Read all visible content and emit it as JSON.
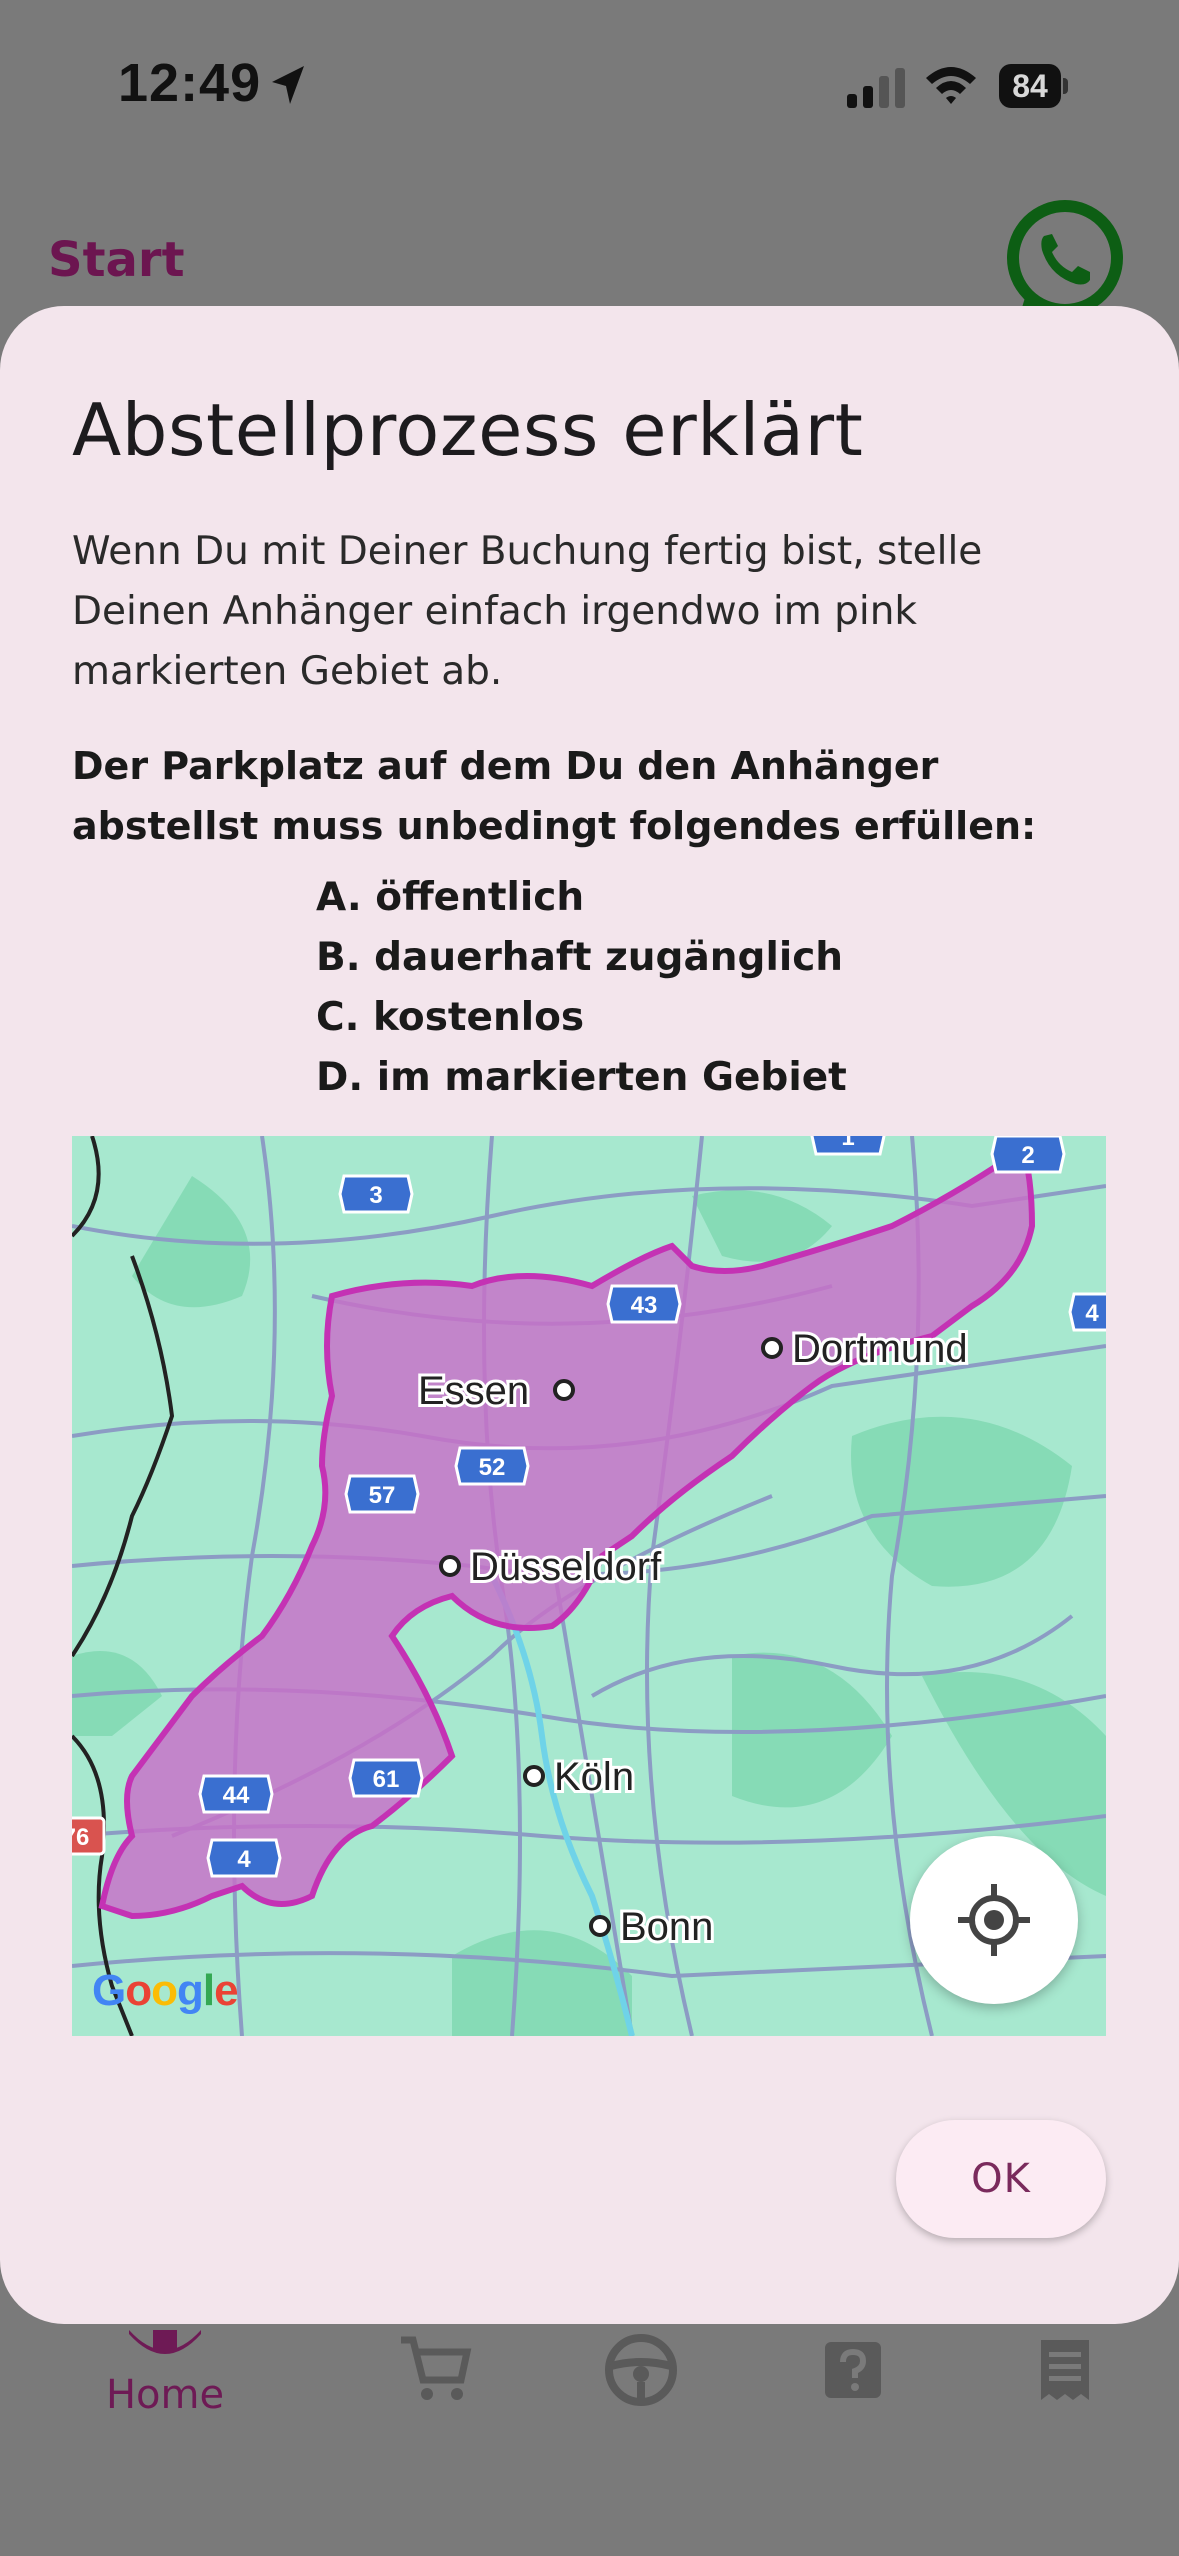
{
  "status_bar": {
    "time": "12:49",
    "battery": "84"
  },
  "app": {
    "title": "Start"
  },
  "bottom_nav": {
    "home_label": "Home"
  },
  "dialog": {
    "title": "Abstellprozess erklärt",
    "intro": "Wenn Du mit Deiner Buchung fertig bist, stelle Deinen Anhänger einfach irgendwo im pink markierten Gebiet ab.",
    "requirement": "Der Parkplatz auf dem Du den Anhänger abstellst muss unbedingt folgendes erfüllen:",
    "requirements": [
      "A. öffentlich",
      "B. dauerhaft zugänglich",
      "C. kostenlos",
      "D. im markierten Gebiet"
    ],
    "ok_label": "OK"
  },
  "map": {
    "google_logo": "Google",
    "cities": [
      "Dortmund",
      "Essen",
      "Düsseldorf",
      "Köln",
      "Bonn"
    ],
    "shields": [
      "3",
      "2",
      "43",
      "52",
      "57",
      "61",
      "44",
      "4",
      "1",
      "4",
      "76"
    ]
  },
  "colors": {
    "dialog_bg": "#f3e5ec",
    "accent": "#6c1550",
    "map_area": "#c86fc8",
    "map_border": "#c432b4",
    "overlay": "#7a7a7a"
  }
}
